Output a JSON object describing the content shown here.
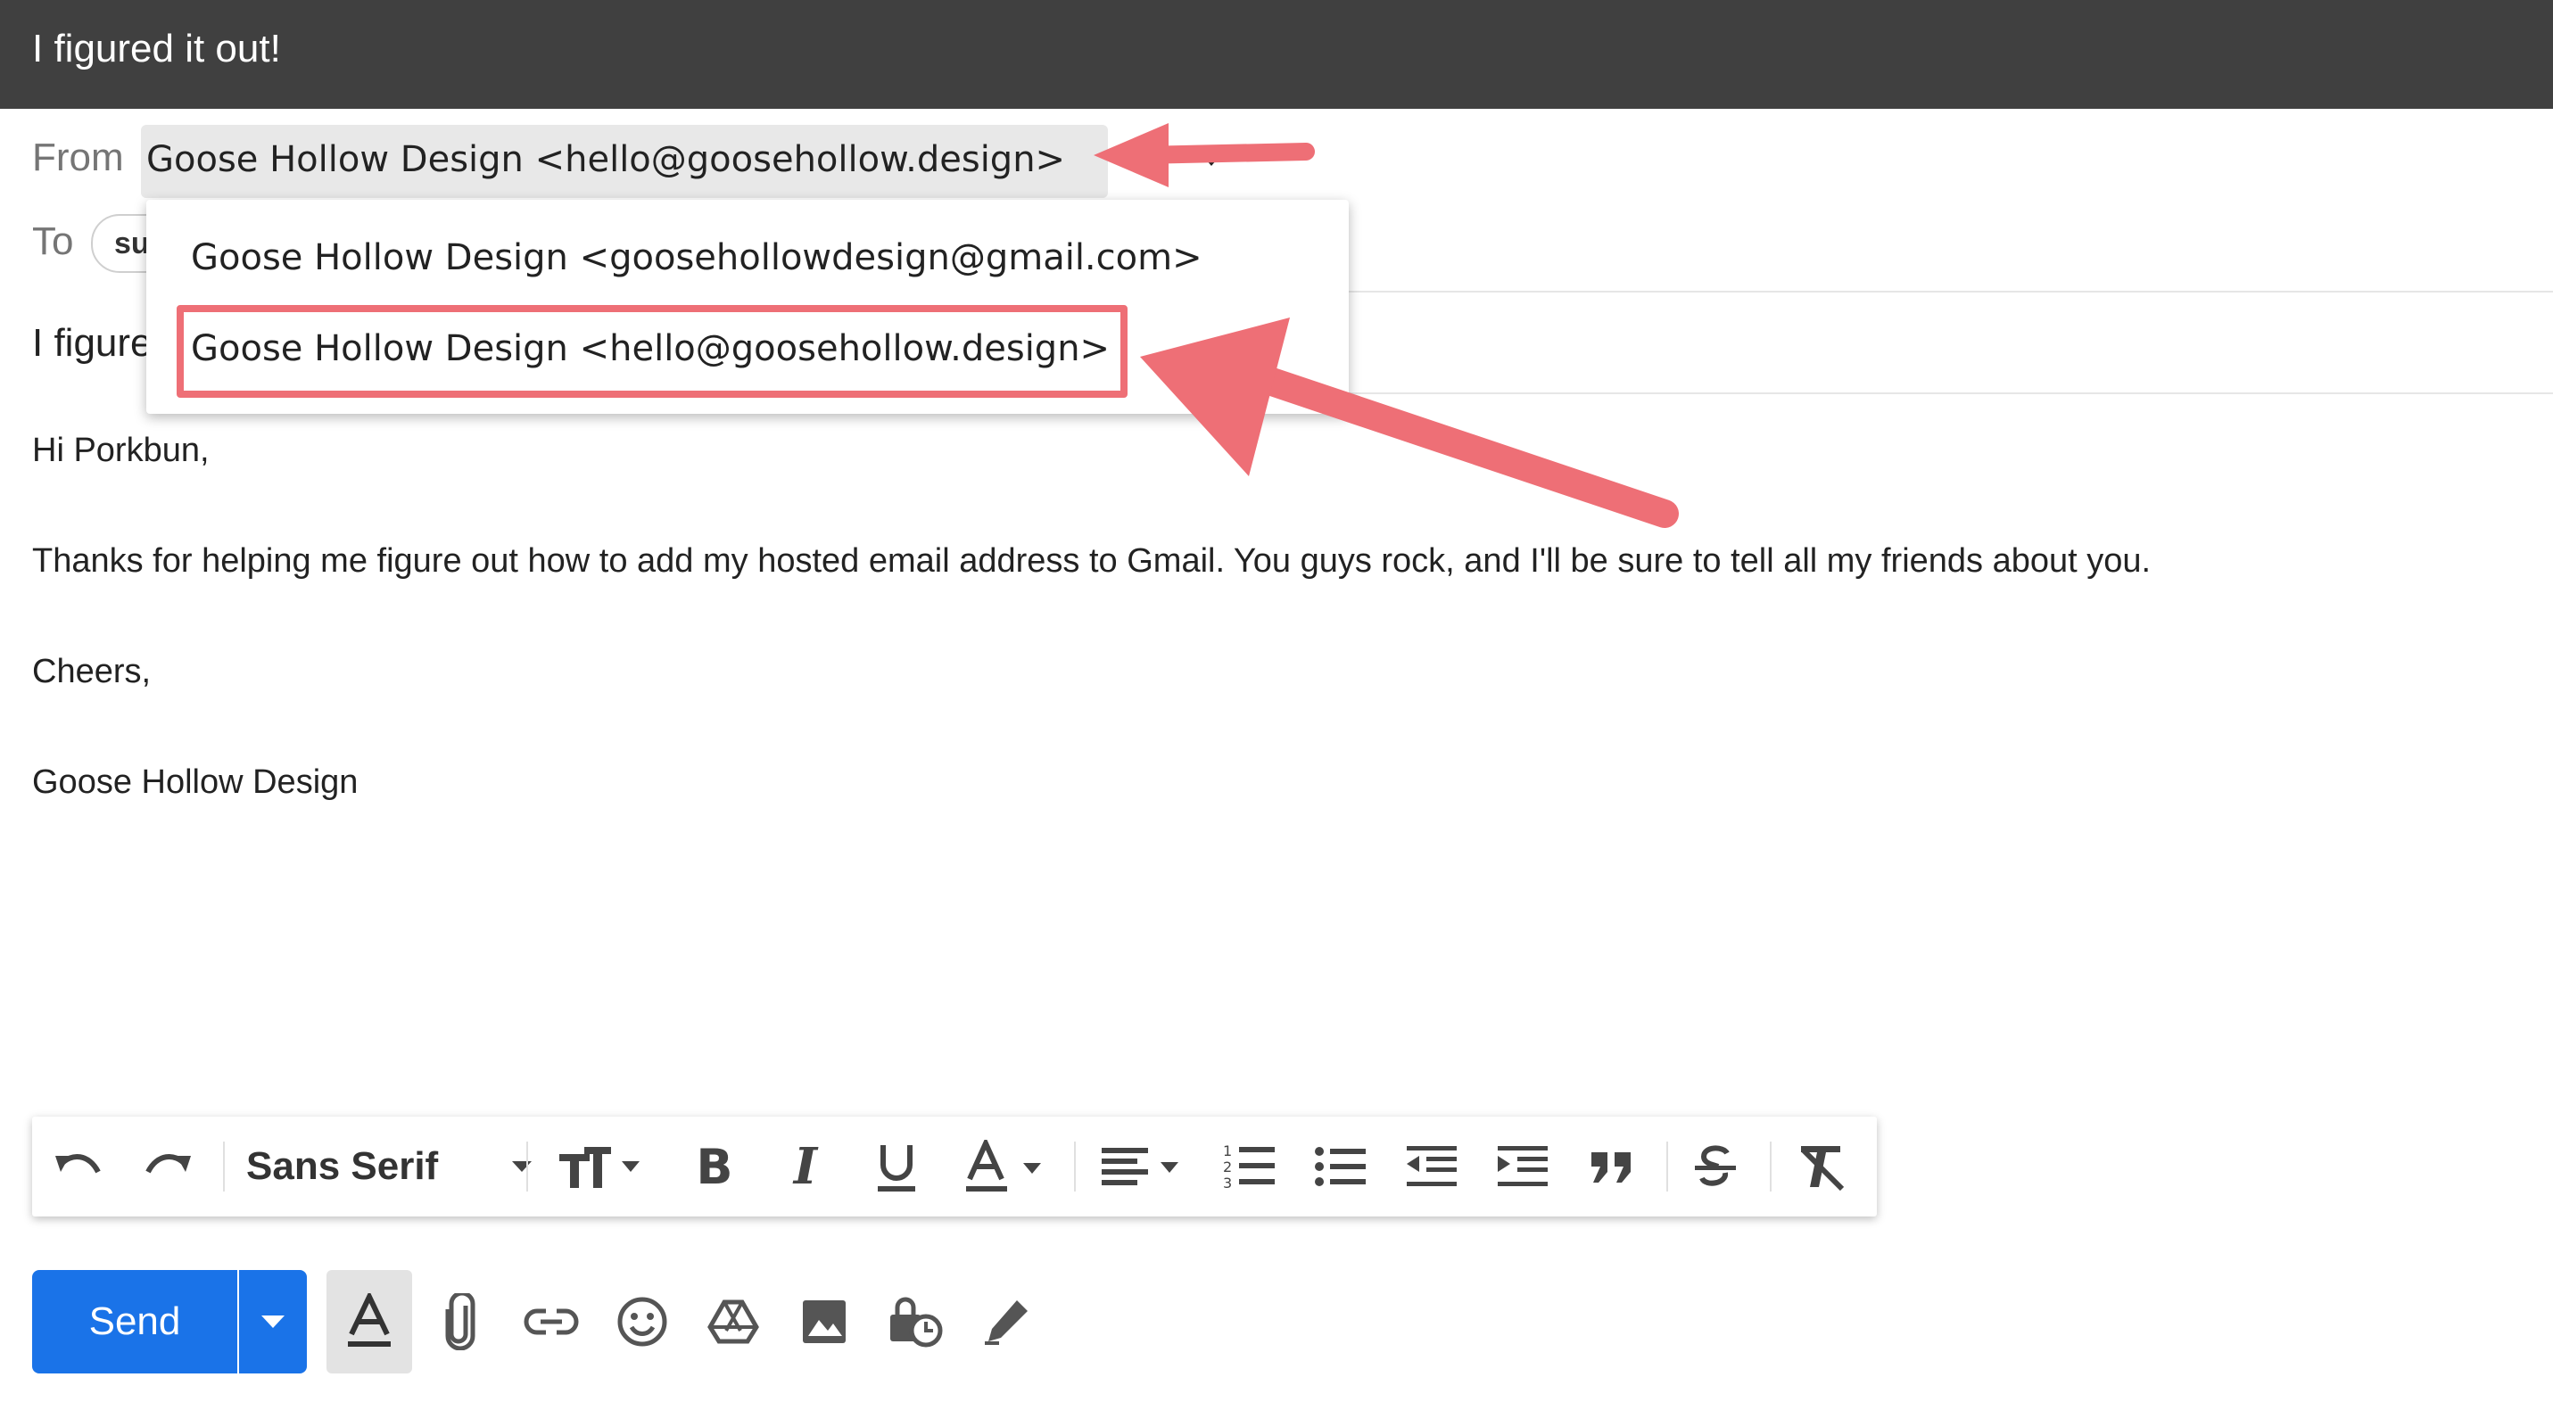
{
  "window": {
    "title": "I figured it out!"
  },
  "from": {
    "label": "From",
    "selected": "Goose Hollow Design <hello@goosehollow.design>",
    "options": [
      "Goose Hollow Design <goosehollowdesign@gmail.com>",
      "Goose Hollow Design <hello@goosehollow.design>"
    ]
  },
  "to": {
    "label": "To",
    "chip_partial": "su"
  },
  "subject": {
    "partial": "I figure"
  },
  "body": {
    "greeting": "Hi Porkbun,",
    "paragraph": "Thanks for helping me figure out how to add my hosted email address to Gmail. You guys rock, and I'll be sure to tell all my friends about you.",
    "closing": "Cheers,",
    "signature": "Goose Hollow Design"
  },
  "toolbar": {
    "font": "Sans Serif"
  },
  "send": {
    "label": "Send"
  },
  "icons": [
    "undo-icon",
    "redo-icon",
    "font-size-icon",
    "bold-icon",
    "italic-icon",
    "underline-icon",
    "text-color-icon",
    "align-icon",
    "numbered-list-icon",
    "bulleted-list-icon",
    "indent-less-icon",
    "indent-more-icon",
    "quote-icon",
    "strikethrough-icon",
    "remove-formatting-icon",
    "formatting-options-icon",
    "attach-icon",
    "link-icon",
    "emoji-icon",
    "drive-icon",
    "photo-icon",
    "confidential-icon",
    "signature-icon"
  ],
  "colors": {
    "title_bar": "#404040",
    "send": "#1a73e8",
    "annotation": "#ee6f76"
  }
}
